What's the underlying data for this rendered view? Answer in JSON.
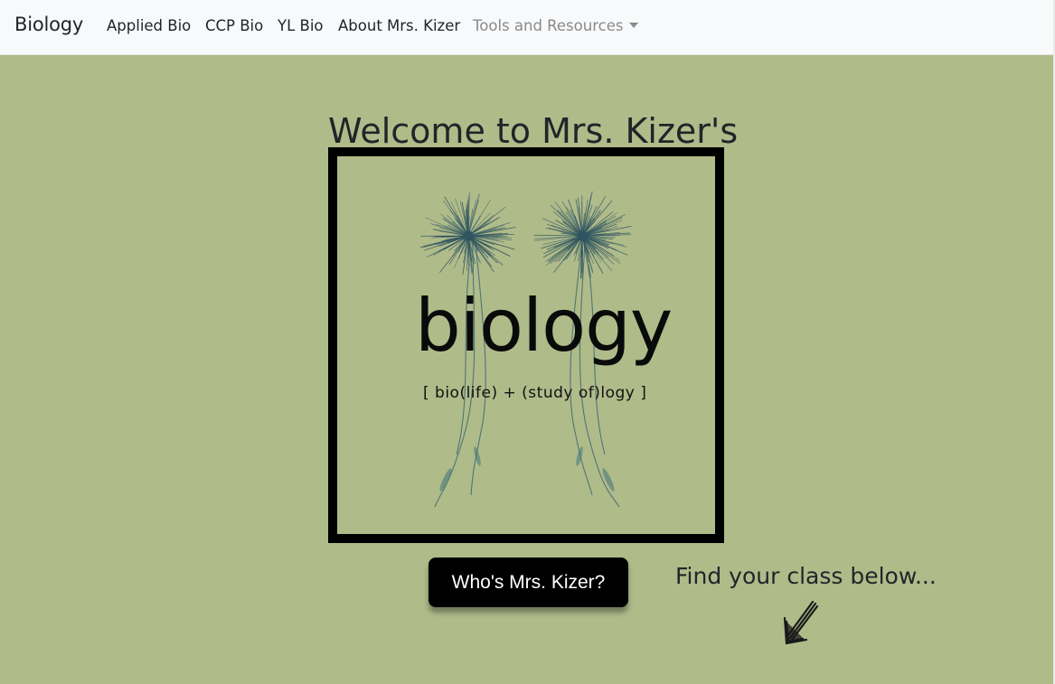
{
  "nav": {
    "brand": "Biology",
    "items": [
      {
        "label": "Applied Bio"
      },
      {
        "label": "CCP Bio"
      },
      {
        "label": "YL Bio"
      },
      {
        "label": "About Mrs. Kizer"
      }
    ],
    "dropdown": {
      "label": "Tools and Resources",
      "icon": "caret-down-icon"
    }
  },
  "main": {
    "title": "Welcome to Mrs. Kizer's",
    "logo": {
      "word": "biology",
      "subtitle": "[ bio(life) + (study of)logy ]"
    },
    "cta_label": "Who's Mrs. Kizer?",
    "find_text": "Find your class below...",
    "arrow_icon": "hand-drawn-arrow-down-left-icon"
  },
  "colors": {
    "background": "#b0bb8a",
    "navbar": "#f8f9fa",
    "flower": "#2f5560",
    "button": "#000000"
  }
}
